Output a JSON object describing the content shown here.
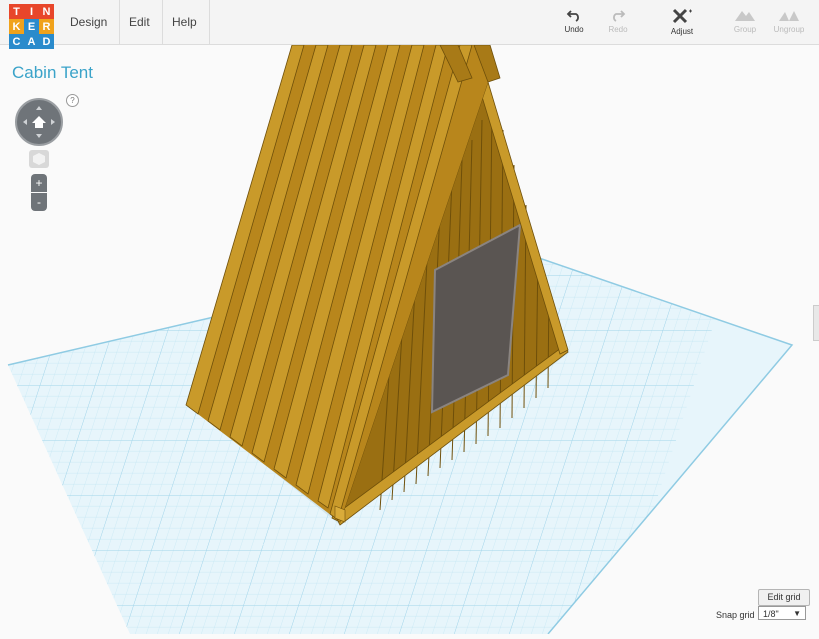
{
  "logo": {
    "letters": [
      "T",
      "I",
      "N",
      "K",
      "E",
      "R",
      "C",
      "A",
      "D"
    ],
    "colors": [
      "#e8462a",
      "#e8462a",
      "#e8462a",
      "#f0a21b",
      "#2a8bcc",
      "#f0a21b",
      "#2a8bcc",
      "#2a8bcc",
      "#2a8bcc"
    ]
  },
  "menu": {
    "design": "Design",
    "edit": "Edit",
    "help": "Help"
  },
  "toolbar": {
    "undo": "Undo",
    "redo": "Redo",
    "adjust": "Adjust",
    "group": "Group",
    "ungroup": "Ungroup"
  },
  "project": {
    "title": "Cabin Tent"
  },
  "nav": {
    "help": "?",
    "zoom_in": "+",
    "zoom_out": "-",
    "icons": [
      "home-icon",
      "viewcube-icon"
    ]
  },
  "grid": {
    "edit_label": "Edit grid",
    "snap_label": "Snap grid",
    "snap_value": "1/8\""
  },
  "colors": {
    "accent": "#3aa3c9",
    "wood": "#b8861c",
    "grid": "#cfeaf5",
    "window": "#5a5552"
  }
}
